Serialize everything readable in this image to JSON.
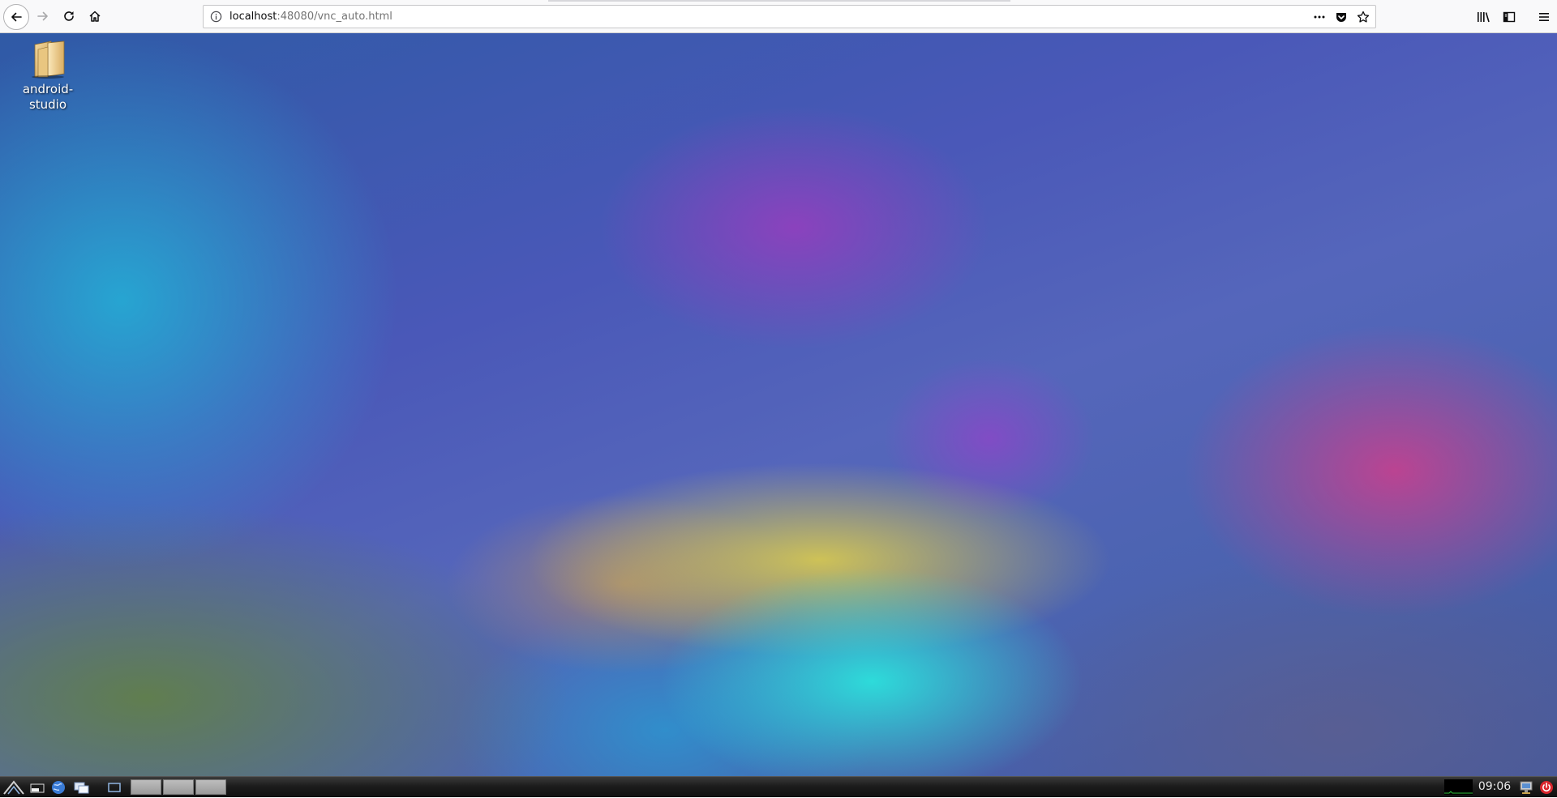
{
  "browser": {
    "url_host": "localhost",
    "url_rest": ":48080/vnc_auto.html",
    "icons": [
      "back-arrow-icon",
      "forward-arrow-icon",
      "reload-icon",
      "home-icon",
      "info-icon",
      "more-dots-icon",
      "pocket-icon",
      "star-icon",
      "library-icon",
      "sidebar-icon",
      "hamburger-menu-icon"
    ]
  },
  "desktop": {
    "icons": [
      {
        "label": "android-\nstudio",
        "icon": "folder-icon"
      }
    ]
  },
  "taskbar": {
    "clock": "09:06",
    "icons": [
      "start-menu-icon",
      "file-manager-icon",
      "web-browser-icon",
      "window-list-icon",
      "show-desktop-icon",
      "network-icon",
      "power-icon"
    ],
    "workspaces": 3
  },
  "colors": {
    "toolbar_bg": "#f9f9fa",
    "taskbar_bg": "#1c1c1c",
    "power_red": "#d9262c"
  }
}
